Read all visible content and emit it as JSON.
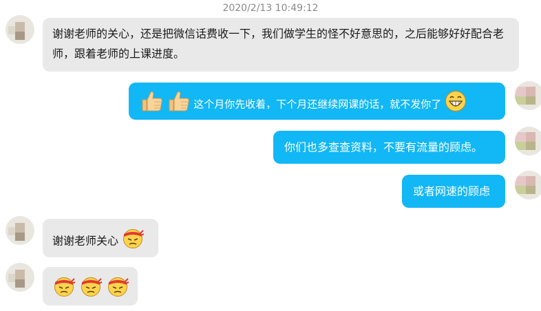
{
  "timestamp": "2020/2/13 10:49:12",
  "messages": [
    {
      "side": "incoming",
      "text": "谢谢老师的关心，还是把微信话费收一下，我们做学生的怪不好意思的，之后能够好好配合老师，跟着老师的上课进度。"
    },
    {
      "side": "outgoing",
      "emojis": [
        "thumbs-up",
        "thumbs-up"
      ],
      "text": "这个月你先收着，下个月还继续网课的话，就不发你了",
      "trailing_emoji": "grin"
    },
    {
      "side": "outgoing",
      "text": "你们也多查查资料，不要有流量的顾虑。"
    },
    {
      "side": "outgoing",
      "text": "或者网速的顾虑"
    },
    {
      "side": "incoming",
      "text": "谢谢老师关心",
      "trailing_emoji": "struggle-headband"
    },
    {
      "side": "incoming",
      "emojis": [
        "struggle-headband",
        "struggle-headband",
        "struggle-headband"
      ]
    }
  ],
  "colors": {
    "incoming_bubble": "#e9e9e9",
    "outgoing_bubble": "#12b7f5",
    "timestamp_text": "#8a8a8a"
  }
}
